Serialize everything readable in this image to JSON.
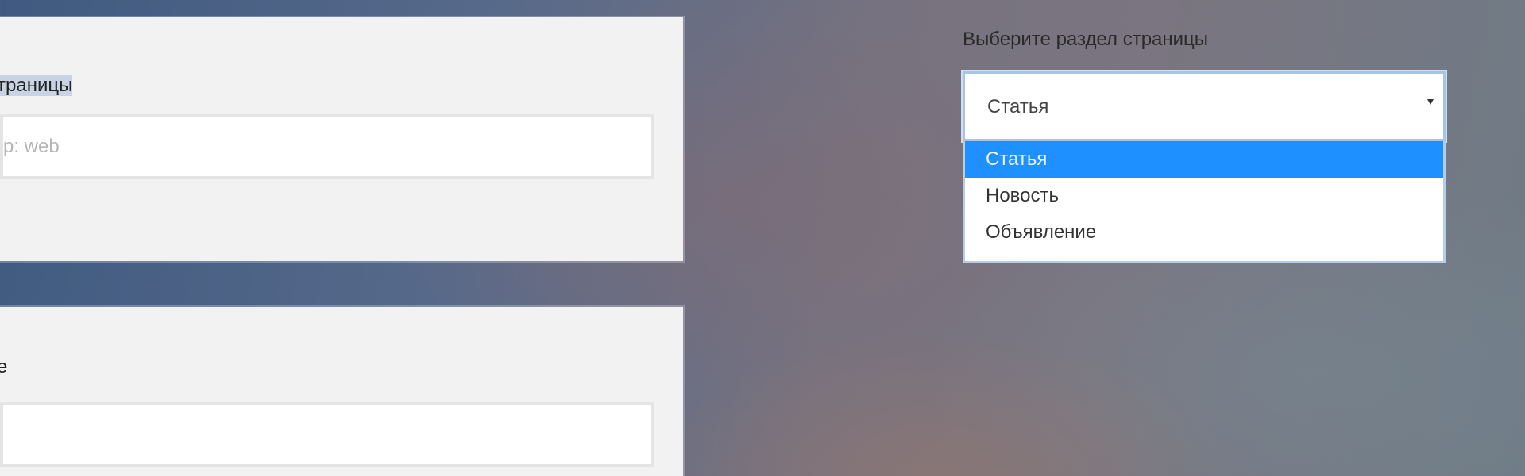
{
  "form": {
    "page_field": {
      "label_visible": "траницы",
      "placeholder": "р: web"
    },
    "second_field": {
      "label_visible": "е",
      "value": ""
    }
  },
  "section_select": {
    "label": "Выберите раздел страницы",
    "selected_value": "Статья",
    "options": [
      {
        "label": "Статья",
        "selected": true
      },
      {
        "label": "Новость",
        "selected": false
      },
      {
        "label": "Объявление",
        "selected": false
      }
    ],
    "highlight_color": "#1e90ff"
  }
}
